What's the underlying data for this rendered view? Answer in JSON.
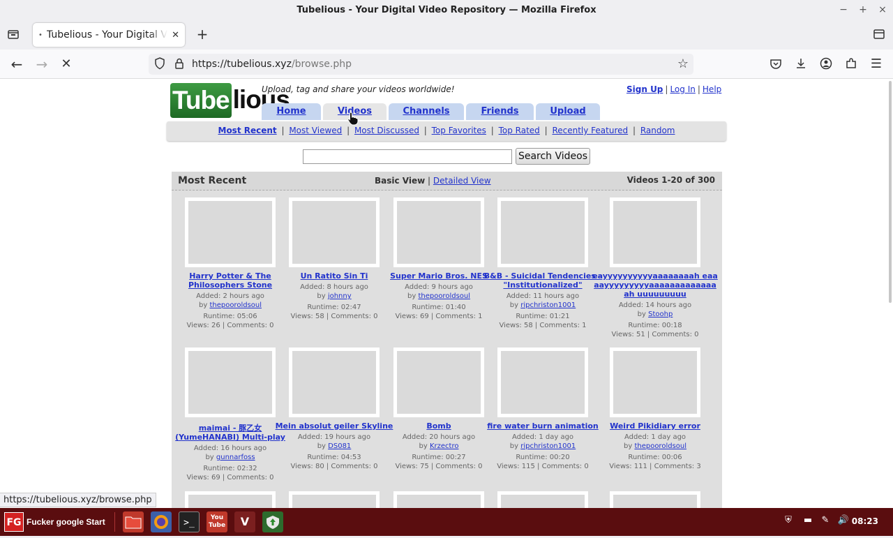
{
  "window": {
    "title": "Tubelious - Your Digital Video Repository — Mozilla Firefox",
    "controls": [
      "−",
      "+",
      "×"
    ]
  },
  "browser": {
    "tab_title": "Tubelious - Your Digital Video Repository",
    "tab_dot": "•",
    "new_tab": "+",
    "url_host": "https://tubelious.xyz",
    "url_path": "/browse.php",
    "status_url": "https://tubelious.xyz/browse.php"
  },
  "site": {
    "logo_box": "Tube",
    "logo_rest": "lious",
    "tagline": "Upload, tag and share your videos worldwide!",
    "toplinks": [
      "Sign Up",
      "Log In",
      "Help"
    ],
    "maintabs": [
      "Home",
      "Videos",
      "Channels",
      "Friends",
      "Upload"
    ],
    "active_tab": "Videos",
    "subnav": [
      "Most Recent",
      "Most Viewed",
      "Most Discussed",
      "Top Favorites",
      "Top Rated",
      "Recently Featured",
      "Random"
    ],
    "search_button": "Search Videos",
    "search_value": ""
  },
  "panel": {
    "title": "Most Recent",
    "basic_view": "Basic View",
    "view_sep": "|",
    "detailed_view": "Detailed View",
    "counts": "Videos 1-20 of 300"
  },
  "videos": [
    {
      "title": "Harry Potter & The Philosophers Stone",
      "added": "Added: 2 hours ago",
      "by": "by",
      "user": "thepooroldsoul",
      "runtime": "Runtime: 05:06",
      "stats": "Views: 26 | Comments: 0"
    },
    {
      "title": "Un Ratito Sin Ti",
      "added": "Added: 8 hours ago",
      "by": "by",
      "user": "johnny",
      "runtime": "Runtime: 02:47",
      "stats": "Views: 58 | Comments: 0"
    },
    {
      "title": "Super Mario Bros. NES",
      "added": "Added: 9 hours ago",
      "by": "by",
      "user": "thepooroldsoul",
      "runtime": "Runtime: 01:40",
      "stats": "Views: 69 | Comments: 1"
    },
    {
      "title": "B&B - Suicidal Tendencies - \"Institutionalized\"",
      "added": "Added: 11 hours ago",
      "by": "by",
      "user": "ripchriston1001",
      "runtime": "Runtime: 01:21",
      "stats": "Views: 58 | Comments: 1"
    },
    {
      "title": "eayyyyyyyyyyaaaaaaaah eaaaayyyyyyyyyaaaaaaaaaaaaaah uuuuuuuuu",
      "added": "Added: 14 hours ago",
      "by": "by",
      "user": "Stoohp",
      "runtime": "Runtime: 00:18",
      "stats": "Views: 51 | Comments: 0"
    },
    {
      "title": "maimai - 豚乙女 (YumeHANABI) Multi-play",
      "added": "Added: 16 hours ago",
      "by": "by",
      "user": "gunnarfoss",
      "runtime": "Runtime: 02:32",
      "stats": "Views: 69 | Comments: 0"
    },
    {
      "title": "Mein absolut geiler Skyline",
      "added": "Added: 19 hours ago",
      "by": "by",
      "user": "DS081",
      "runtime": "Runtime: 04:53",
      "stats": "Views: 80 | Comments: 0"
    },
    {
      "title": "Bomb",
      "added": "Added: 20 hours ago",
      "by": "by",
      "user": "Krzectro",
      "runtime": "Runtime: 00:27",
      "stats": "Views: 75 | Comments: 0"
    },
    {
      "title": "fire water burn animation",
      "added": "Added: 1 day ago",
      "by": "by",
      "user": "ripchriston1001",
      "runtime": "Runtime: 00:20",
      "stats": "Views: 115 | Comments: 0"
    },
    {
      "title": "Weird Pikidiary error",
      "added": "Added: 1 day ago",
      "by": "by",
      "user": "thepooroldsoul",
      "runtime": "Runtime: 00:06",
      "stats": "Views: 111 | Comments: 3"
    }
  ],
  "taskbar": {
    "start_logo": "FG",
    "start_label": "Fucker google Start",
    "clock": "08:23"
  }
}
